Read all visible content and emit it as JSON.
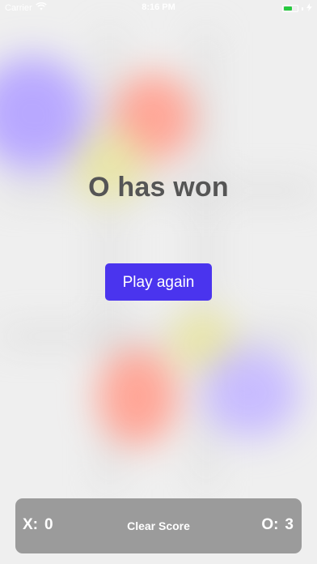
{
  "status_bar": {
    "carrier": "Carrier",
    "time": "8:16 PM",
    "battery_level": 0.6,
    "icons": [
      "wifi-icon",
      "battery-icon",
      "charging-icon"
    ]
  },
  "game": {
    "result_text": "O has won",
    "play_again_label": "Play again"
  },
  "score_bar": {
    "x_label": "X:",
    "x_score": "0",
    "clear_label": "Clear Score",
    "o_label": "O:",
    "o_score": "3"
  },
  "colors": {
    "accent": "#4a34ee",
    "background": "#efefef",
    "score_bar": "#9b9b9b",
    "x_mark": "#ff9a8a",
    "o_mark": "#b8a8ff",
    "highlight": "#e6e2a6",
    "battery": "#27c93f"
  }
}
